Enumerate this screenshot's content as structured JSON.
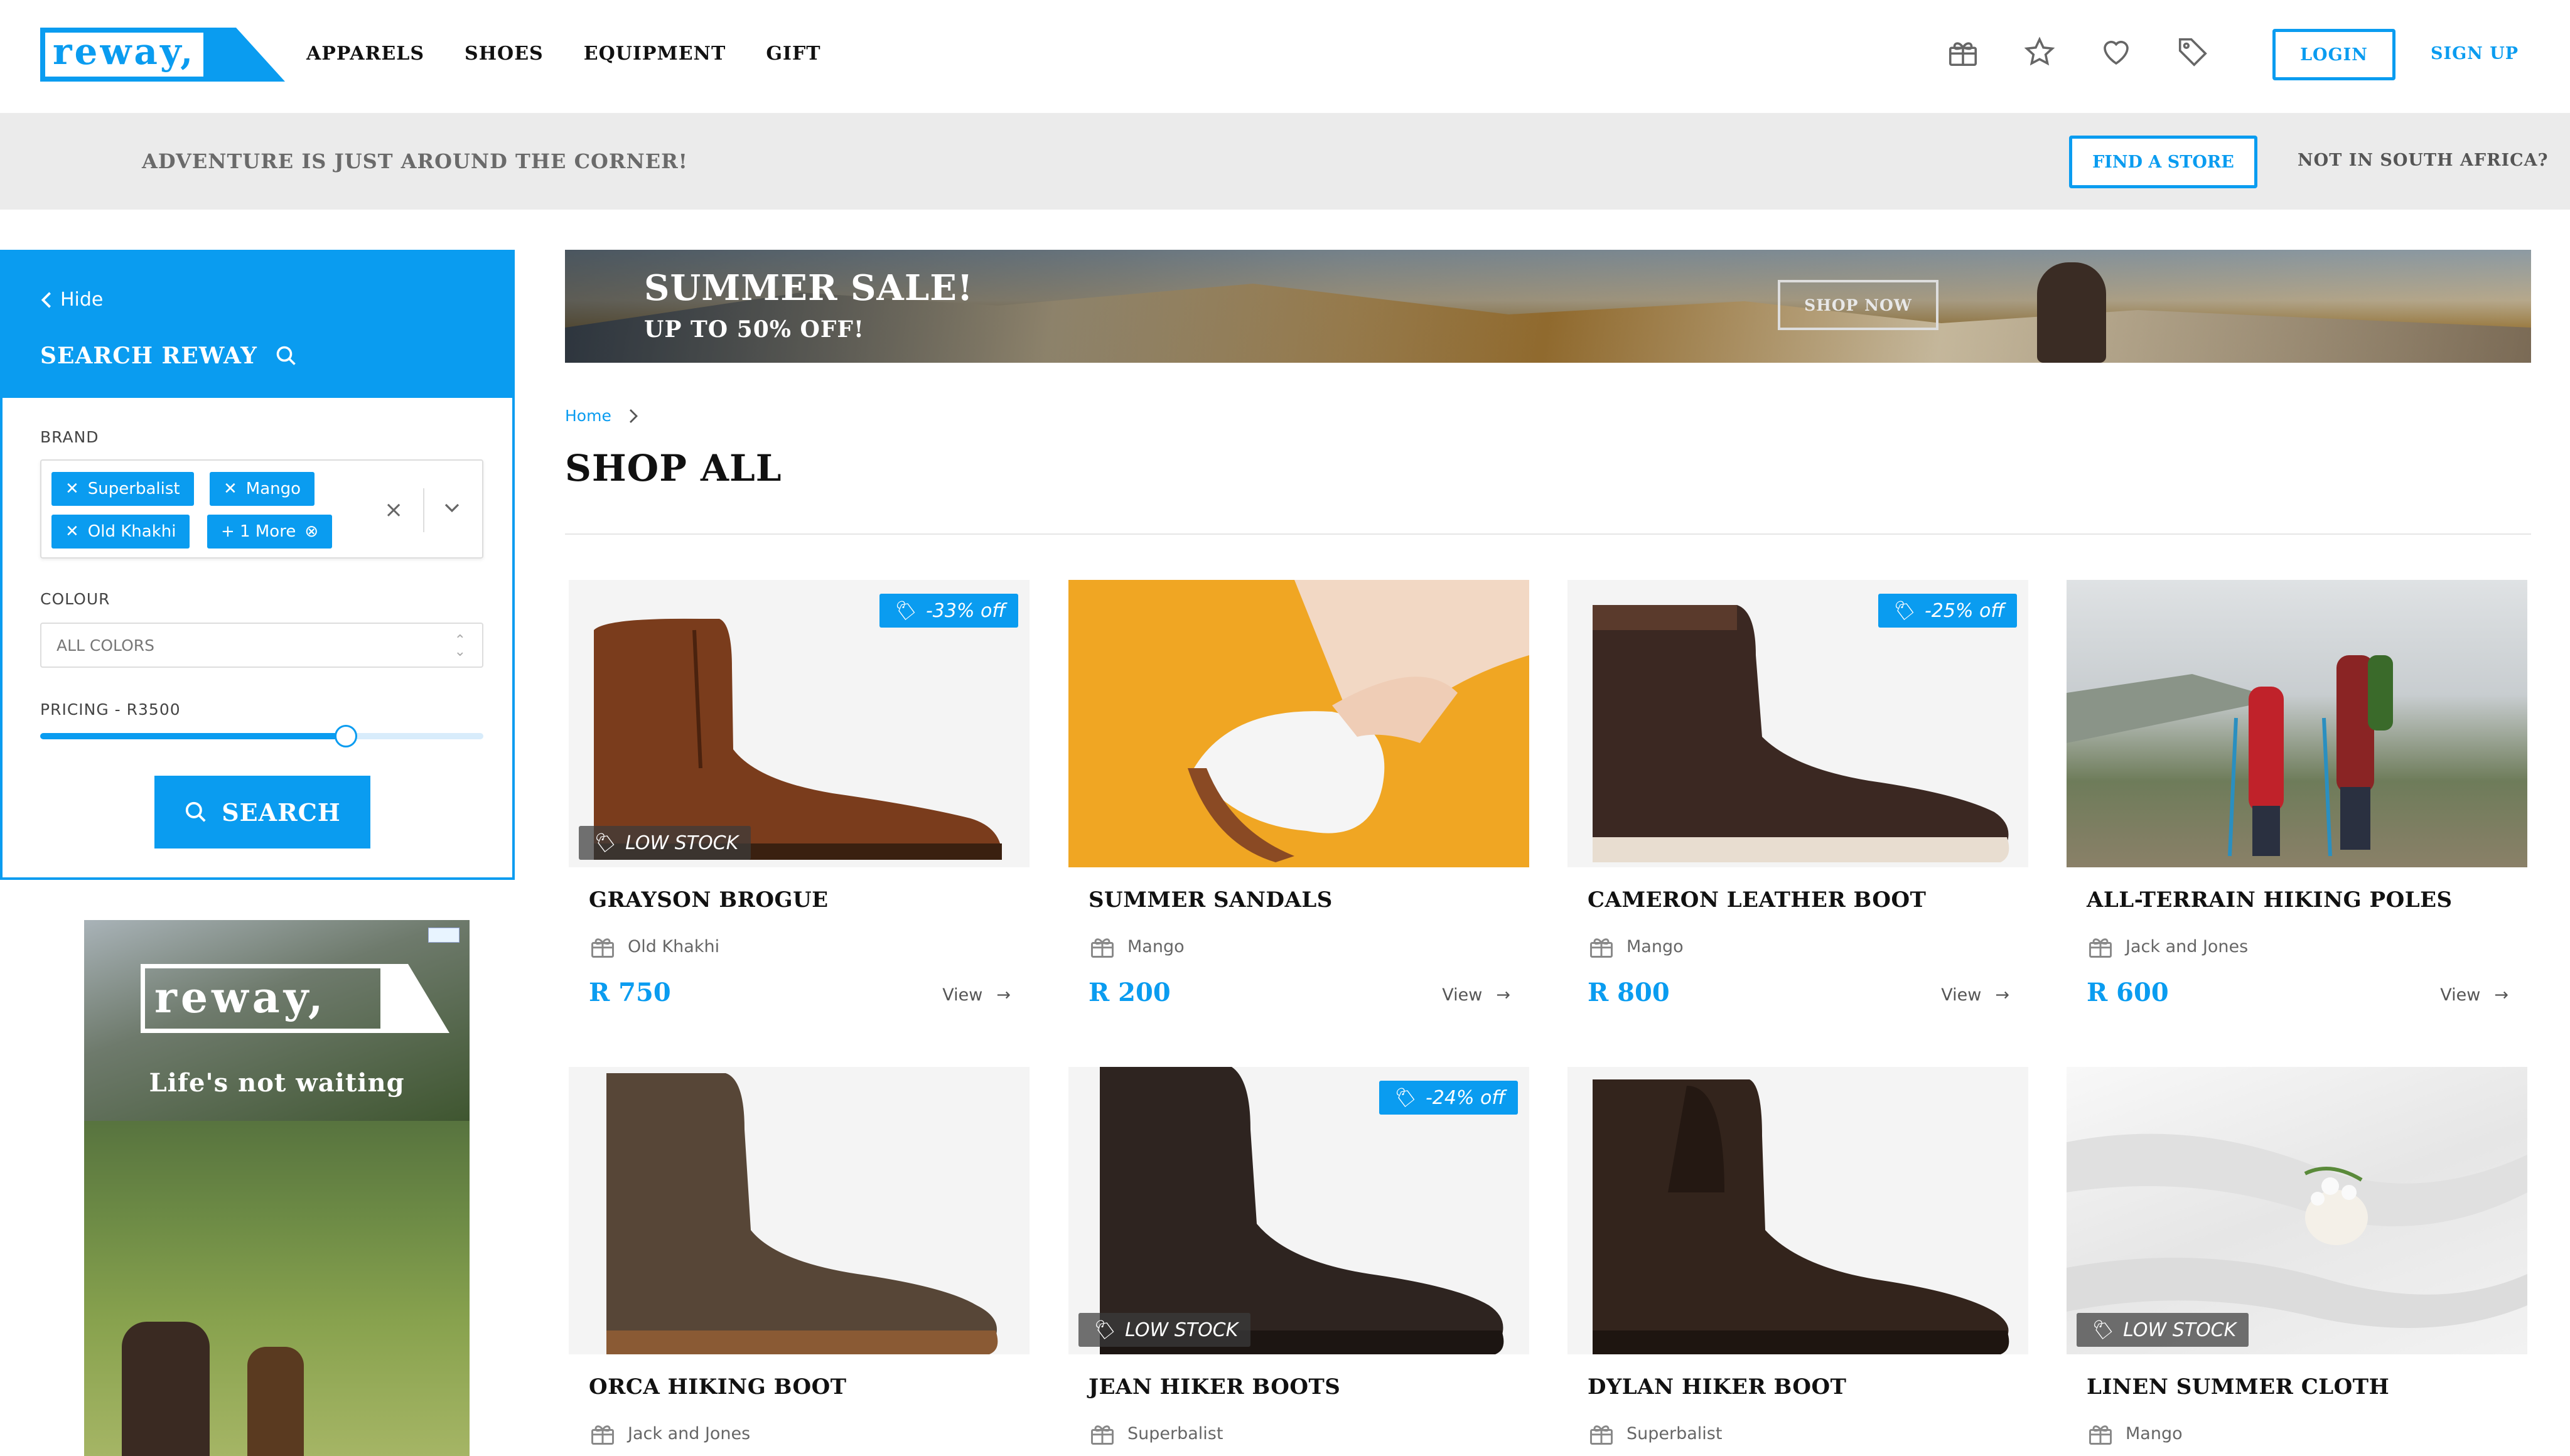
{
  "header": {
    "logo_text": "reway,",
    "nav": [
      "APPARELS",
      "SHOES",
      "EQUIPMENT",
      "GIFT"
    ],
    "icons": [
      "gift-icon",
      "star-icon",
      "heart-icon",
      "tag-icon"
    ],
    "login_label": "LOGIN",
    "signup_label": "SIGN UP"
  },
  "promo_bar": {
    "tagline": "ADVENTURE IS JUST AROUND THE CORNER!",
    "find_store_label": "FIND A STORE",
    "not_sa_label": "NOT IN SOUTH AFRICA?"
  },
  "sidebar": {
    "hide_label": "Hide",
    "title": "SEARCH REWAY",
    "brand_label": "BRAND",
    "brand_chips": [
      "Superbalist",
      "Mango",
      "Old Khakhi",
      "+ 1 More"
    ],
    "colour_label": "COLOUR",
    "colour_value": "ALL COLORS",
    "pricing_label": "PRICING - R3500",
    "pricing_fraction": 0.69,
    "search_label": "SEARCH"
  },
  "ad": {
    "logo_text": "reway,",
    "slogan": "Life's not waiting"
  },
  "banner": {
    "title": "SUMMER SALE!",
    "subtitle": "UP TO 50% OFF!",
    "cta": "SHOP NOW"
  },
  "breadcrumb": {
    "home": "Home"
  },
  "page_title": "SHOP ALL",
  "low_stock_label": "LOW STOCK",
  "view_label": "View",
  "products": [
    {
      "name": "GRAYSON BROGUE",
      "brand": "Old Khakhi",
      "price": "R 750",
      "badge": "-33% off",
      "low_stock": true
    },
    {
      "name": "SUMMER SANDALS",
      "brand": "Mango",
      "price": "R 200",
      "badge": "",
      "low_stock": false
    },
    {
      "name": "CAMERON LEATHER BOOT",
      "brand": "Mango",
      "price": "R 800",
      "badge": "-25% off",
      "low_stock": false
    },
    {
      "name": "ALL-TERRAIN HIKING POLES",
      "brand": "Jack and Jones",
      "price": "R 600",
      "badge": "",
      "low_stock": false
    },
    {
      "name": "ORCA HIKING BOOT",
      "brand": "Jack and Jones",
      "price": "",
      "badge": "",
      "low_stock": false
    },
    {
      "name": "JEAN HIKER BOOTS",
      "brand": "Superbalist",
      "price": "",
      "badge": "-24% off",
      "low_stock": true
    },
    {
      "name": "DYLAN HIKER BOOT",
      "brand": "Superbalist",
      "price": "",
      "badge": "",
      "low_stock": false
    },
    {
      "name": "LINEN SUMMER CLOTH",
      "brand": "Mango",
      "price": "",
      "badge": "",
      "low_stock": true
    }
  ]
}
